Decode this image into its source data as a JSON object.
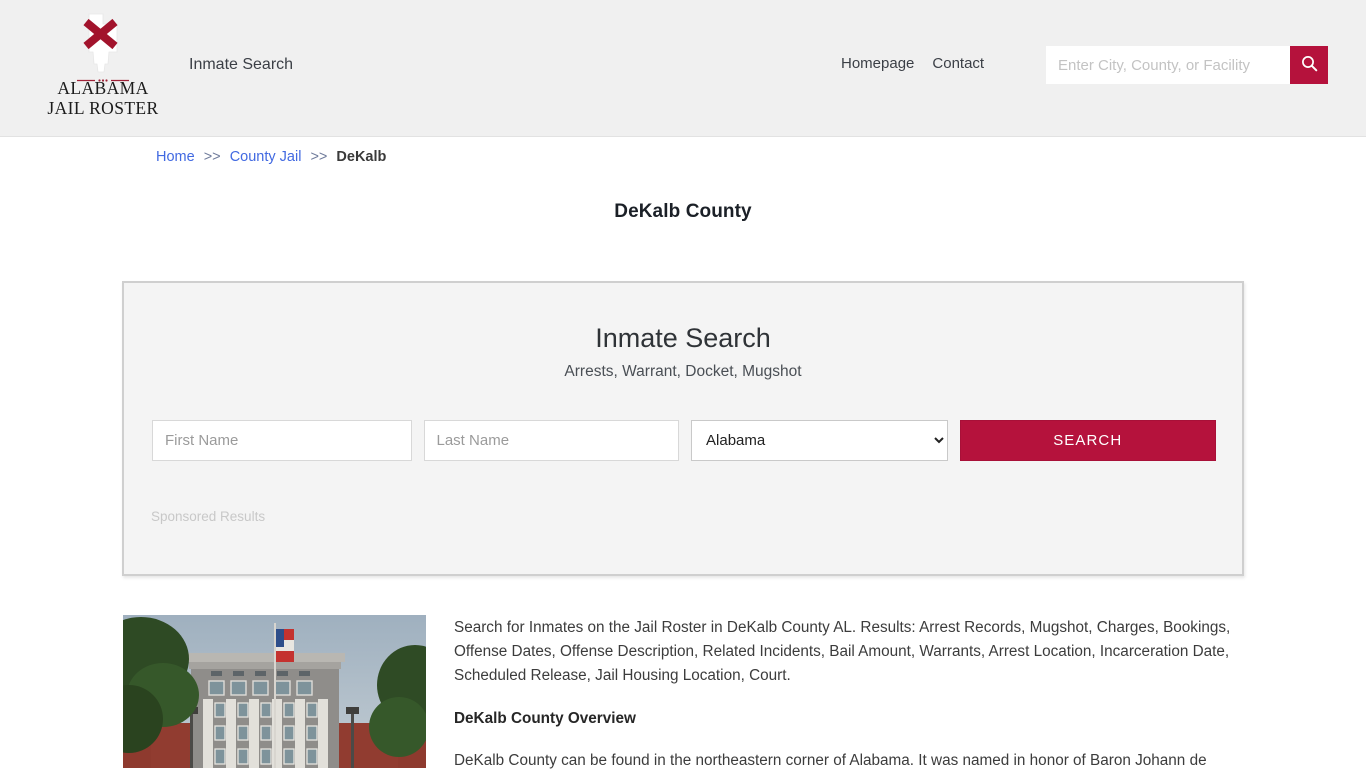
{
  "header": {
    "brand_line1": "ALABAMA",
    "brand_line2": "JAIL ROSTER",
    "logo_icon": "alabama-state-flag-logo",
    "nav_primary": "Inmate Search",
    "links": [
      {
        "label": "Homepage"
      },
      {
        "label": "Contact"
      }
    ],
    "search": {
      "placeholder": "Enter City, County, or Facility",
      "value": "",
      "button_icon": "search-icon"
    },
    "accent_color": "#b5123c",
    "background_color": "#f0f0f0"
  },
  "breadcrumb": {
    "items": [
      {
        "label": "Home",
        "type": "link"
      },
      {
        "label": "County Jail",
        "type": "link"
      },
      {
        "label": "DeKalb",
        "type": "current"
      }
    ],
    "separator": ">>"
  },
  "page": {
    "title": "DeKalb County"
  },
  "search_panel": {
    "heading": "Inmate Search",
    "subheading": "Arrests, Warrant, Docket, Mugshot",
    "first_name": {
      "placeholder": "First Name",
      "value": ""
    },
    "last_name": {
      "placeholder": "Last Name",
      "value": ""
    },
    "state_select": {
      "selected": "Alabama",
      "options": [
        "Alabama"
      ],
      "chevron_icon": "chevron-down-icon"
    },
    "submit_label": "SEARCH",
    "sponsored_label": "Sponsored Results"
  },
  "content": {
    "photo_alt": "dekalb-county-courthouse-photo",
    "intro": "Search for Inmates on the Jail Roster in DeKalb County AL. Results: Arrest Records, Mugshot, Charges, Bookings, Offense Dates, Offense Description, Related Incidents, Bail Amount, Warrants, Arrest Location, Incarceration Date, Scheduled Release, Jail Housing Location, Court.",
    "overview_heading": "DeKalb County Overview",
    "overview_text": "DeKalb County can be found in the northeastern corner of Alabama. It was named in honor of Baron Johann de"
  }
}
